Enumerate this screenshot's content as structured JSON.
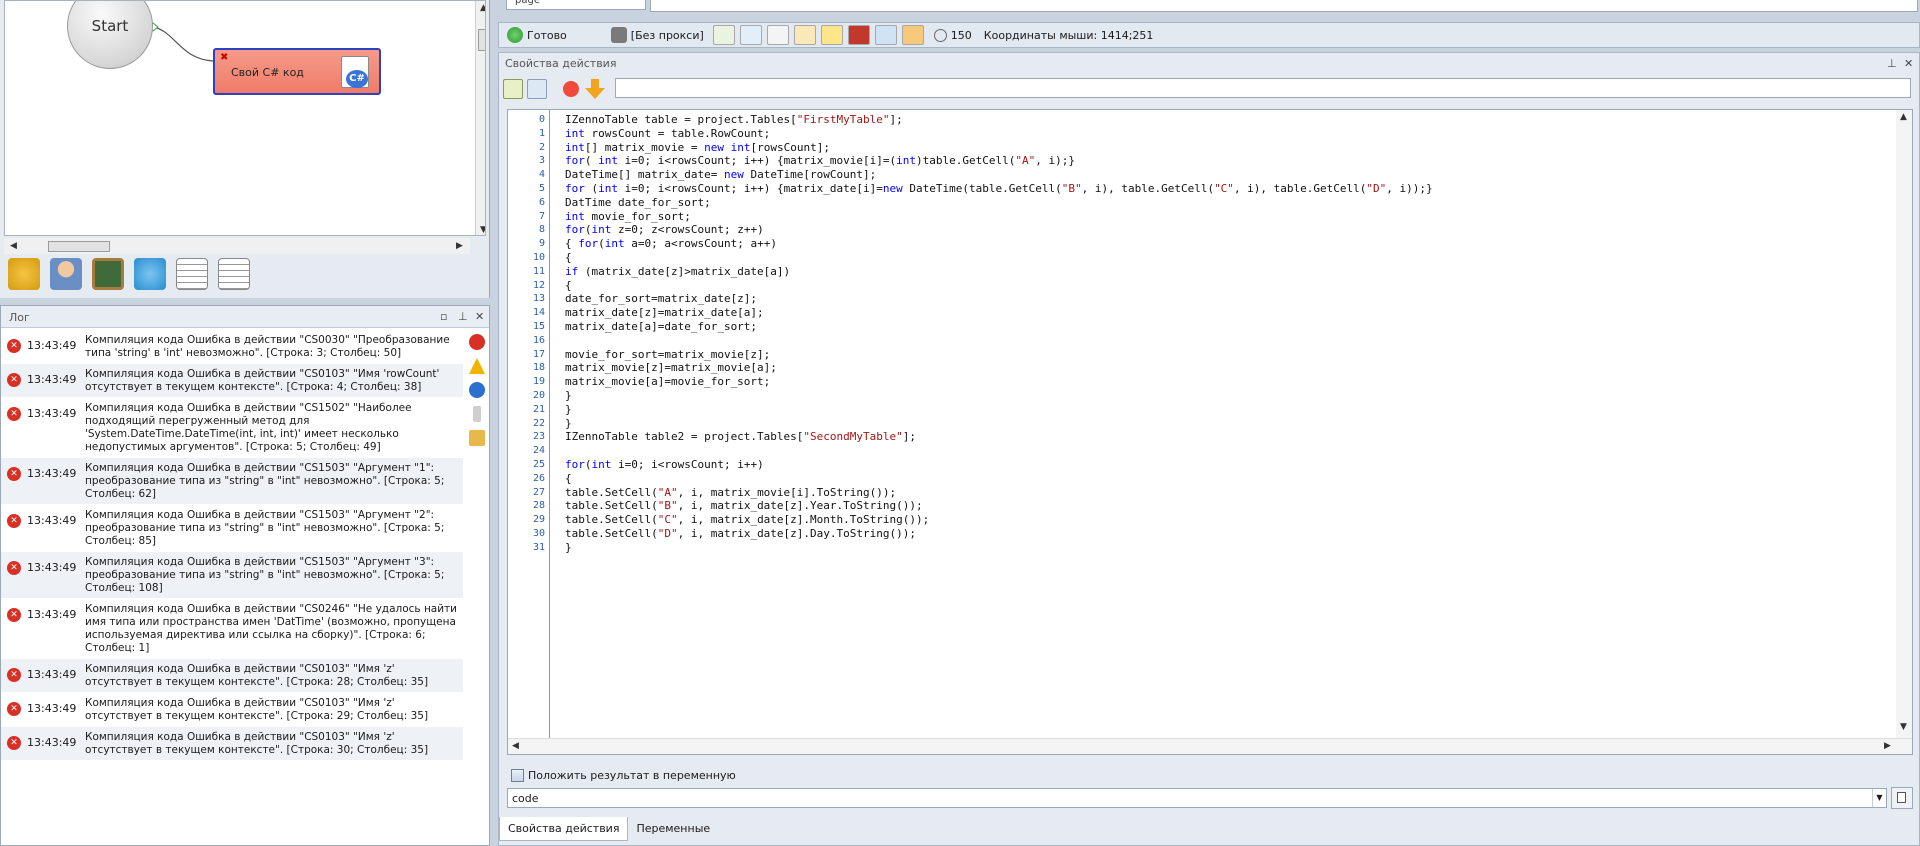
{
  "canvas": {
    "start_label": "Start",
    "node_label": "Свой C# код"
  },
  "log": {
    "title": "Лог",
    "entries": [
      {
        "time": "13:43:49",
        "message": "Компиляция кода  Ошибка в действии \"CS0030\" \"Преобразование типа 'string' в 'int' невозможно\". [Строка: 3; Столбец: 50]"
      },
      {
        "time": "13:43:49",
        "message": "Компиляция кода  Ошибка в действии \"CS0103\" \"Имя 'rowCount' отсутствует в текущем контексте\". [Строка: 4; Столбец: 38]"
      },
      {
        "time": "13:43:49",
        "message": "Компиляция кода  Ошибка в действии \"CS1502\" \"Наиболее подходящий перегруженный метод для 'System.DateTime.DateTime(int, int, int)' имеет несколько недопустимых аргументов\". [Строка: 5; Столбец: 49]"
      },
      {
        "time": "13:43:49",
        "message": "Компиляция кода  Ошибка в действии \"CS1503\" \"Аргумент \"1\": преобразование типа из \"string\" в \"int\" невозможно\". [Строка: 5; Столбец: 62]"
      },
      {
        "time": "13:43:49",
        "message": "Компиляция кода  Ошибка в действии \"CS1503\" \"Аргумент \"2\": преобразование типа из \"string\" в \"int\" невозможно\". [Строка: 5; Столбец: 85]"
      },
      {
        "time": "13:43:49",
        "message": "Компиляция кода  Ошибка в действии \"CS1503\" \"Аргумент \"3\": преобразование типа из \"string\" в \"int\" невозможно\". [Строка: 5; Столбец: 108]"
      },
      {
        "time": "13:43:49",
        "message": "Компиляция кода  Ошибка в действии \"CS0246\" \"Не удалось найти имя типа или пространства имен 'DatTime' (возможно, пропущена используемая директива или ссылка на сборку)\". [Строка: 6; Столбец: 1]"
      },
      {
        "time": "13:43:49",
        "message": "Компиляция кода  Ошибка в действии \"CS0103\" \"Имя 'z' отсутствует в текущем контексте\". [Строка: 28; Столбец: 35]"
      },
      {
        "time": "13:43:49",
        "message": "Компиляция кода  Ошибка в действии \"CS0103\" \"Имя 'z' отсутствует в текущем контексте\". [Строка: 29; Столбец: 35]"
      },
      {
        "time": "13:43:49",
        "message": "Компиляция кода  Ошибка в действии \"CS0103\" \"Имя 'z' отсутствует в текущем контексте\". [Строка: 30; Столбец: 35]"
      }
    ]
  },
  "top": {
    "tab_label": "page"
  },
  "statusbar": {
    "ready": "Готово",
    "proxy": "[Без прокси]",
    "timer_value": "150",
    "mouse_coords": "Координаты мыши: 1414;251"
  },
  "props": {
    "title": "Свойства действия",
    "code_lines": [
      "IZennoTable table = project.Tables[\"FirstMyTable\"];",
      "int rowsCount = table.RowCount;",
      "int[] matrix_movie = new int[rowsCount];",
      "for( int i=0; i<rowsCount; i++) {matrix_movie[i]=(int)table.GetCell(\"A\", i);}",
      "DateTime[] matrix_date= new DateTime[rowCount];",
      "for (int i=0; i<rowsCount; i++) {matrix_date[i]=new DateTime(table.GetCell(\"B\", i), table.GetCell(\"C\", i), table.GetCell(\"D\", i));}",
      "DatTime date_for_sort;",
      "int movie_for_sort;",
      "for(int z=0; z<rowsCount; z++)",
      "{ for(int a=0; a<rowsCount; a++)",
      "{",
      "if (matrix_date[z]>matrix_date[a])",
      "{",
      "date_for_sort=matrix_date[z];",
      "matrix_date[z]=matrix_date[a];",
      "matrix_date[a]=date_for_sort;",
      "",
      "movie_for_sort=matrix_movie[z];",
      "matrix_movie[z]=matrix_movie[a];",
      "matrix_movie[a]=movie_for_sort;",
      "}",
      "}",
      "}",
      "IZennoTable table2 = project.Tables[\"SecondMyTable\"];",
      "",
      "for(int i=0; i<rowsCount; i++)",
      "{",
      "table.SetCell(\"A\", i, matrix_movie[i].ToString());",
      "table.SetCell(\"B\", i, matrix_date[z].Year.ToString());",
      "table.SetCell(\"C\", i, matrix_date[z].Month.ToString());",
      "table.SetCell(\"D\", i, matrix_date[z].Day.ToString());",
      "}"
    ],
    "checkbox_label": "Положить результат в переменную",
    "variable_value": "code",
    "tabs": [
      "Свойства действия",
      "Переменные"
    ]
  }
}
